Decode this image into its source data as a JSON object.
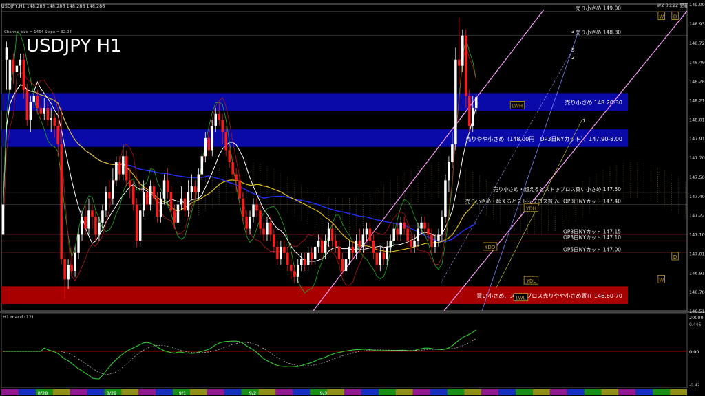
{
  "header": {
    "ohlc": "USDJPY,H1  148.286 148.286 148.286 148.286",
    "time": "9/2 06:22 更新",
    "channel": "Channel size = 1464 Slope = 32.04"
  },
  "title": "USDJPY H1",
  "zones": [
    {
      "label": "売り小さめ 148.20-30",
      "lo": 148.2,
      "hi": 148.3,
      "color": "#0a0aa8"
    },
    {
      "label": "売りやや小さめ（148.00円　OP3日NYカット）：147.90-8.00",
      "lo": 147.9,
      "hi": 148.0,
      "color": "#0a0aa8"
    },
    {
      "label": "買い小さめ、ストップロス売りやや小さめ置在 146.60-70",
      "lo": 146.6,
      "hi": 146.7,
      "color": "#a80000"
    }
  ],
  "levels": [
    {
      "label": "売り小さめ 149.00",
      "price": 149.0,
      "color": "#c0c0c0"
    },
    {
      "label": "売り小さめ 148.80",
      "price": 148.8,
      "color": "#c0c0c0"
    },
    {
      "label": "売り小さめ・超えるとストップロス買い小さめ 147.50",
      "price": 147.5,
      "color": "#c0c0c0"
    },
    {
      "label": "売り小さめ・超えるとストップロス買い、OP3日NYカット 147.40",
      "price": 147.4,
      "color": "#c0c0c0"
    },
    {
      "label": "OP3日NYカット 147.15",
      "price": 147.15,
      "color": "#ff3030"
    },
    {
      "label": "OP3日NYカット 147.10",
      "price": 147.1,
      "color": "#ff3030"
    },
    {
      "label": "OP5日NYカット 147.00",
      "price": 147.0,
      "color": "#ff3030"
    }
  ],
  "tags": [
    {
      "text": "LWH",
      "bar": 150,
      "price": 148.22
    },
    {
      "text": "YDH",
      "bar": 154,
      "price": 147.37
    },
    {
      "text": "YDO",
      "bar": 142,
      "price": 147.05
    },
    {
      "text": "YDL",
      "bar": 154,
      "price": 146.77
    },
    {
      "text": "LWL",
      "bar": 151,
      "price": 146.63
    },
    {
      "text": "W",
      "bar": 192,
      "price": 148.96
    },
    {
      "text": "D",
      "bar": 196,
      "price": 148.96
    },
    {
      "text": "W",
      "bar": 192,
      "price": 146.78
    },
    {
      "text": "D",
      "bar": 196,
      "price": 146.97
    }
  ],
  "channel_labels": [
    "3",
    "5",
    "2",
    "1"
  ],
  "yaxis_main": [
    "149.00",
    "148.930",
    "148.720",
    "148.495",
    "148.286",
    "148.210",
    "148.010",
    "147.910",
    "147.700",
    "147.505",
    "147.400",
    "147.220",
    "147.105",
    "147.010",
    "146.910",
    "146.705",
    "146.510"
  ],
  "yaxis_sub": [
    "0.446",
    "0.00",
    "-0.42"
  ],
  "xaxis": [
    "8/28",
    "8/29",
    "9/1",
    "9/2",
    "9/3"
  ],
  "sub": {
    "label": "H1 macd (12)",
    "level": "0.00",
    "top_label": "20000"
  },
  "chart_data": {
    "type": "candlestick",
    "title": "USDJPY H1",
    "ylim": [
      146.52,
      149.06
    ],
    "candles": [
      [
        147.15,
        147.4,
        148.6,
        147.1
      ],
      [
        148.6,
        148.7,
        148.75,
        148.35
      ],
      [
        148.35,
        148.6,
        148.7,
        148.4
      ],
      [
        148.6,
        148.5,
        148.65,
        148.4
      ],
      [
        148.5,
        148.55,
        148.7,
        148.4
      ],
      [
        148.55,
        148.6,
        148.65,
        148.45
      ],
      [
        148.6,
        148.35,
        148.65,
        148.28
      ],
      [
        148.35,
        148.1,
        148.4,
        148.05
      ],
      [
        148.1,
        148.25,
        148.3,
        148.0
      ],
      [
        148.25,
        148.3,
        148.4,
        148.2
      ],
      [
        148.3,
        148.2,
        148.35,
        148.15
      ],
      [
        148.2,
        148.15,
        148.3,
        148.1
      ],
      [
        148.15,
        148.2,
        148.28,
        148.1
      ],
      [
        148.2,
        148.1,
        148.25,
        148.05
      ],
      [
        148.1,
        148.12,
        148.2,
        148.0
      ],
      [
        148.12,
        148.05,
        148.15,
        147.95
      ],
      [
        148.05,
        147.9,
        148.1,
        147.8
      ],
      [
        147.9,
        146.95,
        148.2,
        146.9
      ],
      [
        146.95,
        146.78,
        147.0,
        146.62
      ],
      [
        146.78,
        146.9,
        146.95,
        146.7
      ],
      [
        146.9,
        146.85,
        147.05,
        146.8
      ],
      [
        146.85,
        147.0,
        147.05,
        146.8
      ],
      [
        147.0,
        147.15,
        147.2,
        146.95
      ],
      [
        147.15,
        147.3,
        147.35,
        147.1
      ],
      [
        147.3,
        147.2,
        147.4,
        147.15
      ],
      [
        147.2,
        147.35,
        147.45,
        147.15
      ],
      [
        147.35,
        147.3,
        147.4,
        147.2
      ],
      [
        147.3,
        147.15,
        147.35,
        147.1
      ],
      [
        147.15,
        147.25,
        147.3,
        147.1
      ],
      [
        147.25,
        147.35,
        147.4,
        147.2
      ],
      [
        147.35,
        147.5,
        147.55,
        147.3
      ],
      [
        147.5,
        147.45,
        147.6,
        147.4
      ],
      [
        147.45,
        147.6,
        147.7,
        147.4
      ],
      [
        147.6,
        147.75,
        147.8,
        147.55
      ],
      [
        147.75,
        147.65,
        147.8,
        147.6
      ],
      [
        147.65,
        147.8,
        147.9,
        147.6
      ],
      [
        147.8,
        147.6,
        147.85,
        147.55
      ],
      [
        147.6,
        147.55,
        147.7,
        147.45
      ],
      [
        147.55,
        147.4,
        147.6,
        147.35
      ],
      [
        147.4,
        147.1,
        147.45,
        147.05
      ],
      [
        147.1,
        147.35,
        147.4,
        147.05
      ],
      [
        147.35,
        147.5,
        147.6,
        147.3
      ],
      [
        147.5,
        147.4,
        147.55,
        147.35
      ],
      [
        147.4,
        147.55,
        147.6,
        147.35
      ],
      [
        147.55,
        147.45,
        147.6,
        147.4
      ],
      [
        147.45,
        147.3,
        147.5,
        147.25
      ],
      [
        147.3,
        147.45,
        147.5,
        147.25
      ],
      [
        147.45,
        147.6,
        147.65,
        147.4
      ],
      [
        147.6,
        147.5,
        147.7,
        147.45
      ],
      [
        147.5,
        147.35,
        147.55,
        147.3
      ],
      [
        147.35,
        147.25,
        147.4,
        147.2
      ],
      [
        147.25,
        147.4,
        147.45,
        147.2
      ],
      [
        147.4,
        147.45,
        147.55,
        147.35
      ],
      [
        147.45,
        147.35,
        147.5,
        147.3
      ],
      [
        147.35,
        147.5,
        147.6,
        147.3
      ],
      [
        147.5,
        147.55,
        147.65,
        147.45
      ],
      [
        147.55,
        147.5,
        147.6,
        147.45
      ],
      [
        147.5,
        147.65,
        147.7,
        147.45
      ],
      [
        147.65,
        147.8,
        147.85,
        147.6
      ],
      [
        147.8,
        147.95,
        148.0,
        147.75
      ],
      [
        147.95,
        147.85,
        148.0,
        147.8
      ],
      [
        147.85,
        148.05,
        148.1,
        147.8
      ],
      [
        148.05,
        148.15,
        148.2,
        148.0
      ],
      [
        148.15,
        148.1,
        148.25,
        148.05
      ],
      [
        148.1,
        148.0,
        148.15,
        147.9
      ],
      [
        148.0,
        147.85,
        148.05,
        147.8
      ],
      [
        147.85,
        147.75,
        147.9,
        147.7
      ],
      [
        147.75,
        147.65,
        147.8,
        147.6
      ],
      [
        147.65,
        147.6,
        147.7,
        147.5
      ],
      [
        147.6,
        147.45,
        147.65,
        147.4
      ],
      [
        147.45,
        147.3,
        147.5,
        147.25
      ],
      [
        147.3,
        147.2,
        147.35,
        147.15
      ],
      [
        147.2,
        147.3,
        147.35,
        147.15
      ],
      [
        147.3,
        147.4,
        147.45,
        147.25
      ],
      [
        147.4,
        147.35,
        147.45,
        147.3
      ],
      [
        147.35,
        147.2,
        147.4,
        147.15
      ],
      [
        147.2,
        147.15,
        147.25,
        147.1
      ],
      [
        147.15,
        147.25,
        147.3,
        147.1
      ],
      [
        147.25,
        147.15,
        147.3,
        147.1
      ],
      [
        147.15,
        147.05,
        147.2,
        147.0
      ],
      [
        147.05,
        146.95,
        147.1,
        146.9
      ],
      [
        146.95,
        147.05,
        147.1,
        146.9
      ],
      [
        147.05,
        147.0,
        147.1,
        146.95
      ],
      [
        147.0,
        146.9,
        147.05,
        146.85
      ],
      [
        146.9,
        146.85,
        146.95,
        146.78
      ],
      [
        146.85,
        146.8,
        146.9,
        146.75
      ],
      [
        146.8,
        146.9,
        146.95,
        146.75
      ],
      [
        146.9,
        146.95,
        147.0,
        146.85
      ],
      [
        146.95,
        146.9,
        147.0,
        146.85
      ],
      [
        146.9,
        147.0,
        147.05,
        146.85
      ],
      [
        147.0,
        146.95,
        147.05,
        146.9
      ],
      [
        146.95,
        147.05,
        147.1,
        146.9
      ],
      [
        147.05,
        147.1,
        147.15,
        147.0
      ],
      [
        147.1,
        147.0,
        147.15,
        146.95
      ],
      [
        147.0,
        147.1,
        147.15,
        146.95
      ],
      [
        147.1,
        147.2,
        147.25,
        147.05
      ],
      [
        147.2,
        147.1,
        147.25,
        147.05
      ],
      [
        147.1,
        147.05,
        147.15,
        147.0
      ],
      [
        147.05,
        146.95,
        147.1,
        146.9
      ],
      [
        146.95,
        146.85,
        147.0,
        146.82
      ],
      [
        146.85,
        146.95,
        147.0,
        146.8
      ],
      [
        146.95,
        147.05,
        147.1,
        146.9
      ],
      [
        147.05,
        147.0,
        147.1,
        146.95
      ],
      [
        147.0,
        147.1,
        147.15,
        146.95
      ],
      [
        147.1,
        147.05,
        147.2,
        147.0
      ],
      [
        147.05,
        147.15,
        147.2,
        147.0
      ],
      [
        147.15,
        147.2,
        147.25,
        147.1
      ],
      [
        147.2,
        147.1,
        147.25,
        147.05
      ],
      [
        147.1,
        147.0,
        147.15,
        146.95
      ],
      [
        147.0,
        146.9,
        147.05,
        146.85
      ],
      [
        146.9,
        147.0,
        147.05,
        146.85
      ],
      [
        147.0,
        146.95,
        147.05,
        146.9
      ],
      [
        146.95,
        147.05,
        147.1,
        146.9
      ],
      [
        147.05,
        147.1,
        147.15,
        147.0
      ],
      [
        147.1,
        147.2,
        147.25,
        147.05
      ],
      [
        147.2,
        147.15,
        147.25,
        147.1
      ],
      [
        147.15,
        147.25,
        147.3,
        147.1
      ],
      [
        147.25,
        147.2,
        147.3,
        147.15
      ],
      [
        147.2,
        147.1,
        147.25,
        147.05
      ],
      [
        147.1,
        147.05,
        147.15,
        147.0
      ],
      [
        147.05,
        147.1,
        147.15,
        147.0
      ],
      [
        147.1,
        147.2,
        147.25,
        147.05
      ],
      [
        147.2,
        147.25,
        147.3,
        147.15
      ],
      [
        147.25,
        147.2,
        147.3,
        147.15
      ],
      [
        147.2,
        147.15,
        147.25,
        147.1
      ],
      [
        147.15,
        147.05,
        147.2,
        147.0
      ],
      [
        147.05,
        147.1,
        147.15,
        147.0
      ],
      [
        147.1,
        147.15,
        147.2,
        147.05
      ],
      [
        147.15,
        147.3,
        147.35,
        147.1
      ],
      [
        147.3,
        147.6,
        147.65,
        147.25
      ],
      [
        147.6,
        147.75,
        147.8,
        147.5
      ],
      [
        147.75,
        147.9,
        148.0,
        147.7
      ],
      [
        147.9,
        148.6,
        148.7,
        147.85
      ],
      [
        148.6,
        148.55,
        148.95,
        148.4
      ],
      [
        148.55,
        148.8,
        148.85,
        148.5
      ],
      [
        148.8,
        148.3,
        148.85,
        148.2
      ],
      [
        148.3,
        148.05,
        148.35,
        148.0
      ],
      [
        148.05,
        148.2,
        148.3,
        148.0
      ],
      [
        148.2,
        148.29,
        148.32,
        148.15
      ]
    ]
  }
}
